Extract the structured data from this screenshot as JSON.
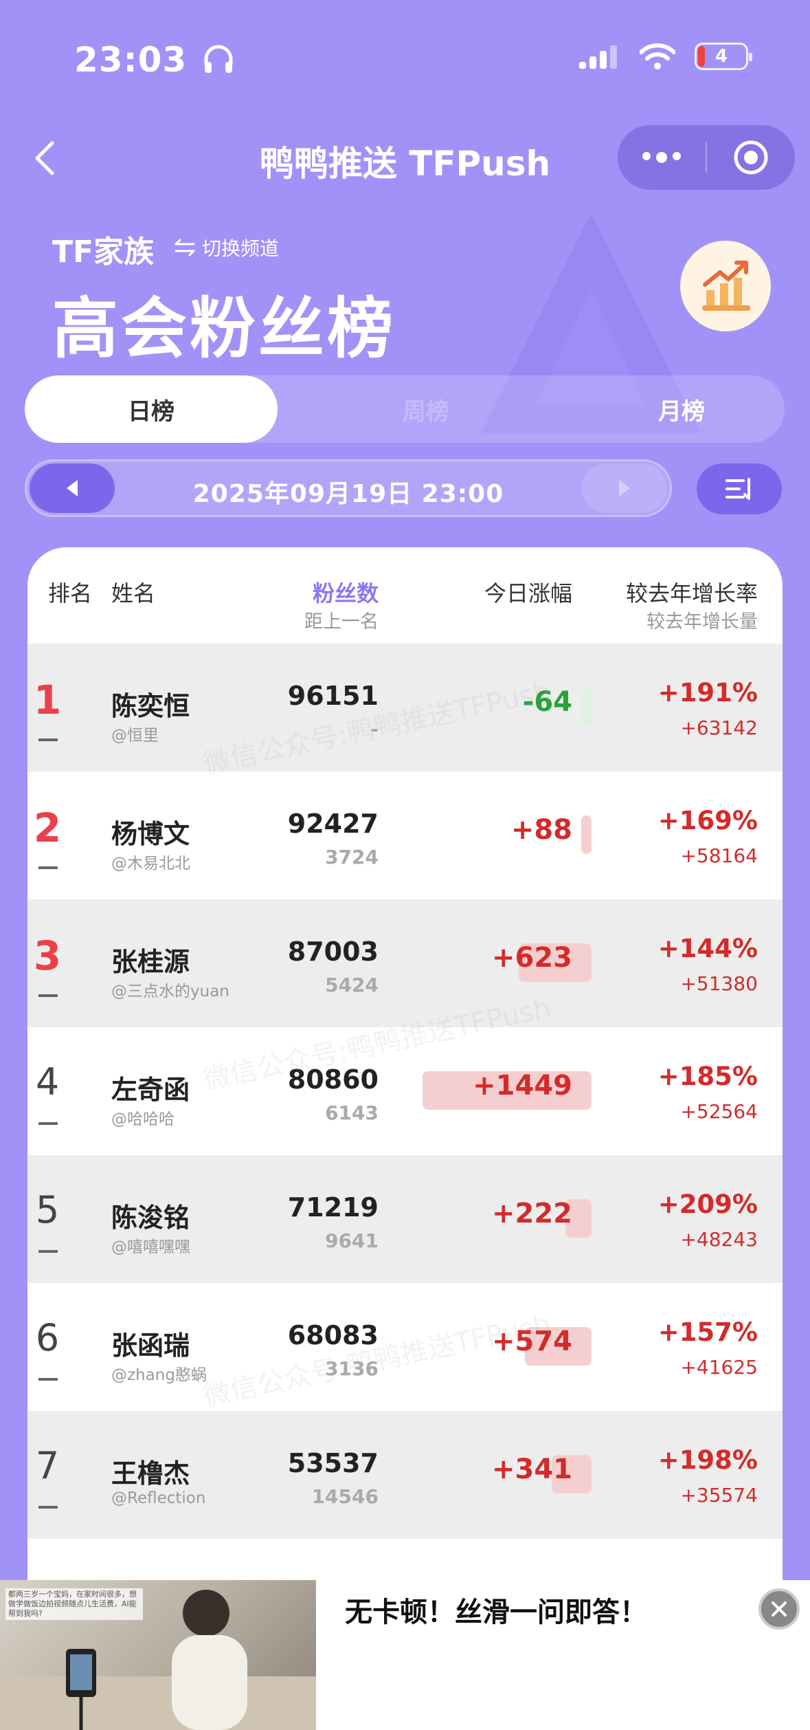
{
  "status": {
    "time": "23:03",
    "battery": "4"
  },
  "nav": {
    "title": "鸭鸭推送 TFPush"
  },
  "header": {
    "family": "TF家族",
    "switch_label": "切换频道",
    "title": "高会粉丝榜"
  },
  "tabs": [
    {
      "label": "日榜"
    },
    {
      "label": "周榜"
    },
    {
      "label": "月榜"
    }
  ],
  "date": {
    "text": "2025年09月19日 23:00"
  },
  "table": {
    "headers": {
      "rank": "排名",
      "name": "姓名",
      "fans": "粉丝数",
      "gap": "距上一名",
      "today": "今日涨幅",
      "yoy_rate": "较去年增长率",
      "yoy_amount": "较去年增长量"
    },
    "rows": [
      {
        "rank": "1",
        "name": "陈奕恒",
        "handle": "@恒里",
        "fans": "96151",
        "gap": "-",
        "delta": "-64",
        "yoy_rate": "+191%",
        "yoy_amount": "+63142"
      },
      {
        "rank": "2",
        "name": "杨博文",
        "handle": "@木易北北",
        "fans": "92427",
        "gap": "3724",
        "delta": "+88",
        "yoy_rate": "+169%",
        "yoy_amount": "+58164"
      },
      {
        "rank": "3",
        "name": "张桂源",
        "handle": "@三点水的yuan",
        "fans": "87003",
        "gap": "5424",
        "delta": "+623",
        "yoy_rate": "+144%",
        "yoy_amount": "+51380"
      },
      {
        "rank": "4",
        "name": "左奇函",
        "handle": "@哈哈哈",
        "fans": "80860",
        "gap": "6143",
        "delta": "+1449",
        "yoy_rate": "+185%",
        "yoy_amount": "+52564"
      },
      {
        "rank": "5",
        "name": "陈浚铭",
        "handle": "@嘻嘻嘿嘿",
        "fans": "71219",
        "gap": "9641",
        "delta": "+222",
        "yoy_rate": "+209%",
        "yoy_amount": "+48243"
      },
      {
        "rank": "6",
        "name": "张函瑞",
        "handle": "@zhang憨蜗",
        "fans": "68083",
        "gap": "3136",
        "delta": "+574",
        "yoy_rate": "+157%",
        "yoy_amount": "+41625"
      },
      {
        "rank": "7",
        "name": "王橹杰",
        "handle": "@Reflection",
        "fans": "53537",
        "gap": "14546",
        "delta": "+341",
        "yoy_rate": "+198%",
        "yoy_amount": "+35574"
      }
    ]
  },
  "watermark": "微信公众号:鸭鸭推送TFPush",
  "ad": {
    "headline": "无卡顿！丝滑一问即答！",
    "caption": "都两三岁一个宝妈，在家时间很多，想做学做饭边拍视频随点儿生活费，AI能帮到我吗?"
  },
  "colors": {
    "background": "#a192f8",
    "accent": "#7c67ec",
    "up": "#d42a2a",
    "down": "#2ba03a",
    "top_rank": "#ec3f4a"
  }
}
